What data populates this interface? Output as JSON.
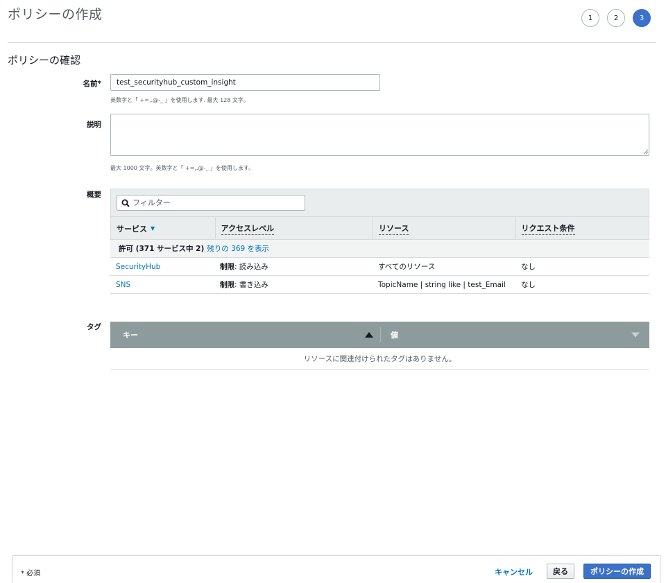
{
  "page": {
    "title": "ポリシーの作成"
  },
  "steps": [
    "1",
    "2",
    "3"
  ],
  "review": {
    "section_title": "ポリシーの確認",
    "name_label": "名前*",
    "name_value": "test_securityhub_custom_insight",
    "name_hint": "英数字と「 +=,.@-_ 」を使用します. 最大 128 文字。",
    "description_label": "説明",
    "description_value": "",
    "description_hint": "最大 1000 文字。英数字と「 +=,.@-_ 」を使用します。"
  },
  "summary": {
    "label": "概要",
    "filter_placeholder": "フィルター",
    "columns": [
      "サービス",
      "アクセスレベル",
      "リソース",
      "リクエスト条件"
    ],
    "group_label": "許可 (371 サービス中 2)",
    "group_link": "残りの 369 を表示",
    "rows": [
      {
        "service": "SecurityHub",
        "access_strong": "制限",
        "access_rest": ": 読み込み",
        "resource": "すべてのリソース",
        "condition": "なし"
      },
      {
        "service": "SNS",
        "access_strong": "制限",
        "access_rest": ": 書き込み",
        "resource": "TopicName | string like | test_Email",
        "condition": "なし"
      }
    ]
  },
  "tags": {
    "label": "タグ",
    "key_header": "キー",
    "value_header": "値",
    "empty_message": "リソースに関連付けられたタグはありません。"
  },
  "footer": {
    "required_note": "* 必須",
    "cancel": "キャンセル",
    "back": "戻る",
    "create": "ポリシーの作成"
  },
  "colors": {
    "primary": "#3b71c8",
    "link": "#0073bb",
    "tags_header": "#8d9b9c"
  },
  "icons": {
    "filter": "search-icon",
    "sort": "caret-down-icon",
    "tag_key_sort": "triangle-up-icon",
    "tag_value_sort": "triangle-down-icon"
  }
}
